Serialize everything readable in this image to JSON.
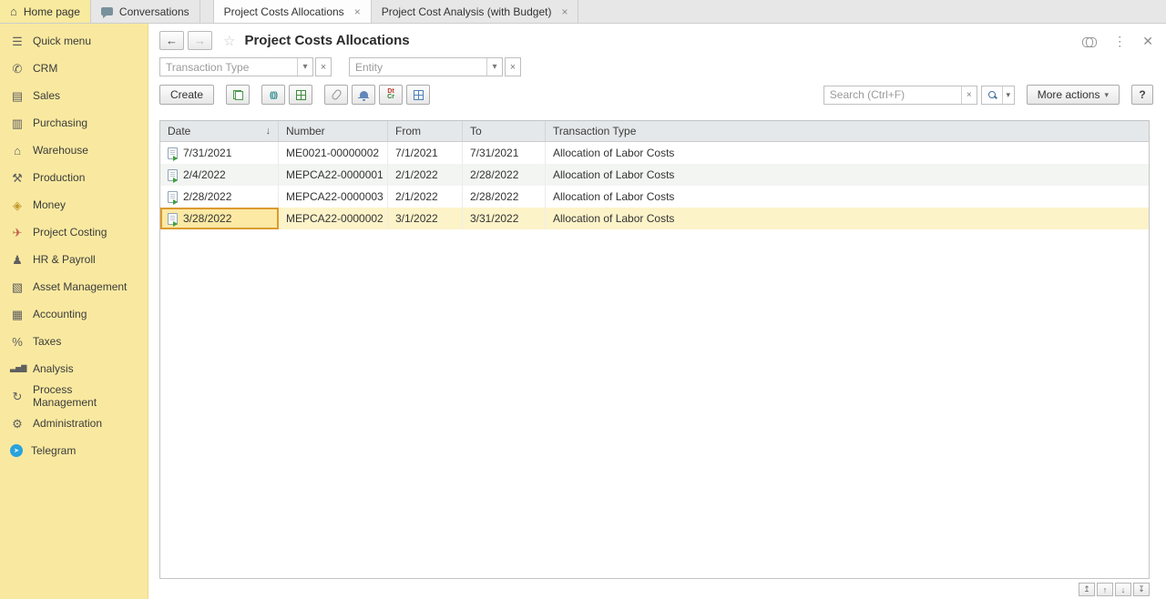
{
  "tabbar": {
    "tabs": [
      {
        "label": "Home page",
        "glyph": "⌂"
      },
      {
        "label": "Conversations"
      },
      {
        "label": "Project Costs Allocations",
        "close_glyph": "×"
      },
      {
        "label": "Project Cost Analysis (with Budget)",
        "close_glyph": "×"
      }
    ]
  },
  "sidebar": {
    "items": [
      {
        "label": "Quick menu",
        "icon": "menu-icon",
        "glyph": "☰"
      },
      {
        "label": "CRM",
        "icon": "crm-icon",
        "glyph": "✆"
      },
      {
        "label": "Sales",
        "icon": "sales-icon",
        "glyph": "▤"
      },
      {
        "label": "Purchasing",
        "icon": "purchasing-icon",
        "glyph": "▥"
      },
      {
        "label": "Warehouse",
        "icon": "warehouse-icon",
        "glyph": "⌂"
      },
      {
        "label": "Production",
        "icon": "production-icon",
        "glyph": "⚒"
      },
      {
        "label": "Money",
        "icon": "money-icon",
        "glyph": "◈"
      },
      {
        "label": "Project Costing",
        "icon": "project-costing-icon",
        "glyph": "✈"
      },
      {
        "label": "HR & Payroll",
        "icon": "hr-payroll-icon",
        "glyph": "♟"
      },
      {
        "label": "Asset Management",
        "icon": "asset-management-icon",
        "glyph": "▧"
      },
      {
        "label": "Accounting",
        "icon": "accounting-icon",
        "glyph": "▦"
      },
      {
        "label": "Taxes",
        "icon": "taxes-icon",
        "glyph": "%"
      },
      {
        "label": "Analysis",
        "icon": "analysis-icon",
        "glyph": "▃▅▇"
      },
      {
        "label": "Process Management",
        "icon": "process-management-icon",
        "glyph": "↻"
      },
      {
        "label": "Administration",
        "icon": "administration-icon",
        "glyph": "⚙"
      },
      {
        "label": "Telegram",
        "icon": "telegram-icon",
        "glyph": "➤"
      }
    ]
  },
  "page": {
    "title": "Project Costs Allocations",
    "back_glyph": "←",
    "forward_glyph": "→",
    "favorite_glyph": "☆",
    "menu_glyph": "⋮",
    "close_glyph": "✕"
  },
  "filters": {
    "transaction_type_placeholder": "Transaction Type",
    "entity_placeholder": "Entity",
    "dropdown_glyph": "▾",
    "clear_glyph": "×"
  },
  "toolbar": {
    "create_label": "Create",
    "broadcast_glyph": "(())",
    "dtcr_top": "Dt",
    "dtcr_bottom": "Cr",
    "search_placeholder": "Search (Ctrl+F)",
    "search_clear_glyph": "×",
    "dropdown_glyph": "▾",
    "more_actions_label": "More actions",
    "help_label": "?"
  },
  "table": {
    "columns": {
      "date": "Date",
      "number": "Number",
      "from": "From",
      "to": "To",
      "type": "Transaction Type"
    },
    "sort_glyph": "↓",
    "rows": [
      {
        "date": "7/31/2021",
        "number": "ME0021-00000002",
        "from": "7/1/2021",
        "to": "7/31/2021",
        "type": "Allocation of Labor Costs"
      },
      {
        "date": "2/4/2022",
        "number": "MEPCA22-0000001",
        "from": "2/1/2022",
        "to": "2/28/2022",
        "type": "Allocation of Labor Costs"
      },
      {
        "date": "2/28/2022",
        "number": "MEPCA22-0000003",
        "from": "2/1/2022",
        "to": "2/28/2022",
        "type": "Allocation of Labor Costs"
      },
      {
        "date": "3/28/2022",
        "number": "MEPCA22-0000002",
        "from": "3/1/2022",
        "to": "3/31/2022",
        "type": "Allocation of Labor Costs"
      }
    ]
  },
  "pager": {
    "first_glyph": "↥",
    "up_glyph": "↑",
    "down_glyph": "↓",
    "last_glyph": "↧"
  },
  "colors": {
    "sidebar_bg": "#f9e9a0",
    "table_header_bg": "#e5e8ea",
    "selected_row_bg": "#fdf3c9",
    "selected_cell_bg": "#fbe9a4",
    "selected_cell_border": "#dc9a30",
    "telegram_blue": "#29a3dd"
  }
}
